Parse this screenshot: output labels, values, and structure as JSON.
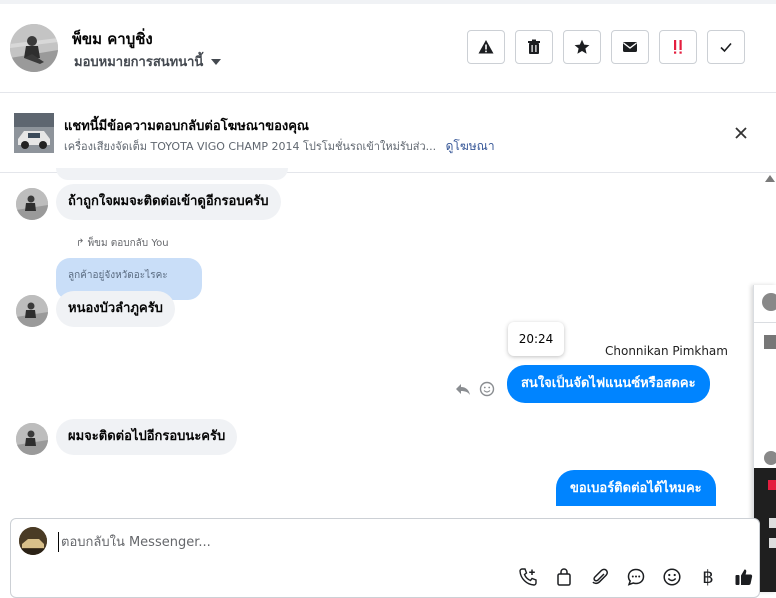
{
  "header": {
    "contact_name": "พ็ขม คาบูชิ่ง",
    "assign_label": "มอบหมายการสนทนานี้",
    "actions": [
      {
        "name": "warning",
        "label": "Report spam"
      },
      {
        "name": "trash",
        "label": "Delete"
      },
      {
        "name": "star",
        "label": "Star"
      },
      {
        "name": "envelope",
        "label": "Mark unread"
      },
      {
        "name": "follow-up",
        "label": "Follow up"
      },
      {
        "name": "check",
        "label": "Done"
      }
    ]
  },
  "ad_banner": {
    "title": "แชทนี้มีข้อความตอบกลับต่อโฆษณาของคุณ",
    "description": "เครื่องเสียงจัดเต็ม TOYOTA VIGO CHAMP 2014 โปรโมชั่นรถเข้าใหม่รับส่ว...",
    "link_label": "ดูโฆษณา"
  },
  "messages": {
    "msg1": "ถ้าถูกใจผมจะติดต่อเข้าดูอีกรอบครับ",
    "reply_meta": "พ็ขม ตอบกลับ You",
    "quoted": "ลูกค้าอยู่จังหวัดอะไรคะ",
    "msg2": "หนองบัวลำภูครับ",
    "tooltip_time": "20:24",
    "sender": "Chonnikan Pimkham",
    "msg3": "สนใจเป็นจัดไฟแนนซ์หรือสดคะ",
    "msg4": "ผมจะติดต่อไปอีกรอบนะครับ",
    "msg5": "ขอเบอร์ติดต่อได้ไหมคะ"
  },
  "composer": {
    "placeholder": "ตอบกลับใน Messenger...",
    "tools": [
      "phone-plus-icon",
      "shopping-bag-icon",
      "paperclip-icon",
      "chat-bubble-icon",
      "smiley-icon",
      "baht-icon",
      "thumbs-up-icon"
    ],
    "baht_symbol": "฿"
  },
  "colors": {
    "accent": "#0084ff",
    "incoming_bubble": "#f0f2f5",
    "quote_bubble": "#c9def8",
    "link": "#385898",
    "follow_up": "#e41e3f"
  }
}
